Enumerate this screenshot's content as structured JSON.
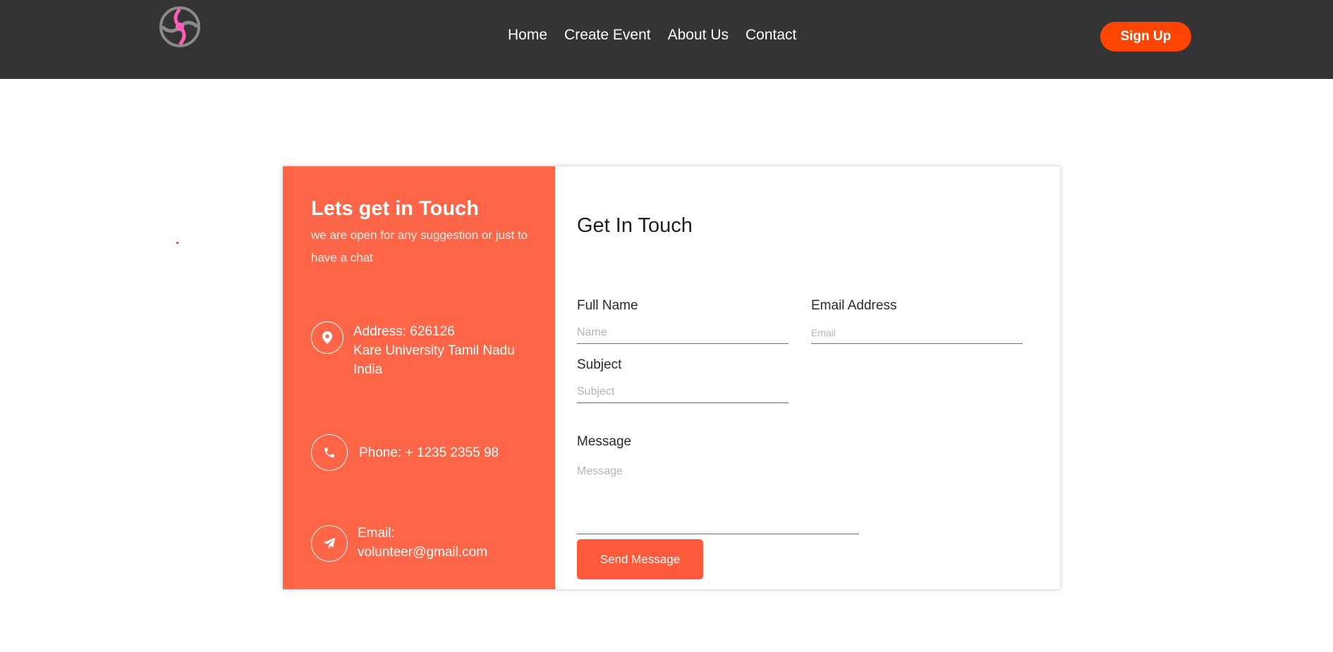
{
  "header": {
    "nav": [
      "Home",
      "Create Event",
      "About Us",
      "Contact"
    ],
    "signup_label": "Sign Up"
  },
  "colors": {
    "header_bg": "#343434",
    "accent": "#ff4500",
    "panel": "#ff6648",
    "send_button": "#ff5a3b"
  },
  "info": {
    "title": "Lets get in Touch",
    "subtitle": "we are open for any suggestion or just to have a chat",
    "address": [
      "Address: 626126",
      "Kare University Tamil Nadu",
      "India"
    ],
    "phone": "Phone: + 1235 2355 98",
    "email": [
      "Email:",
      "volunteer@gmail.com"
    ],
    "icons": [
      "map-pin-icon",
      "phone-icon",
      "paper-plane-icon"
    ]
  },
  "form": {
    "title": "Get In Touch",
    "full_name_label": "Full Name",
    "full_name_placeholder": "Name",
    "email_label": "Email Address",
    "email_placeholder": "Email",
    "subject_label": "Subject",
    "subject_placeholder": "Subject",
    "message_label": "Message",
    "message_placeholder": "Message",
    "send_label": "Send Message"
  }
}
